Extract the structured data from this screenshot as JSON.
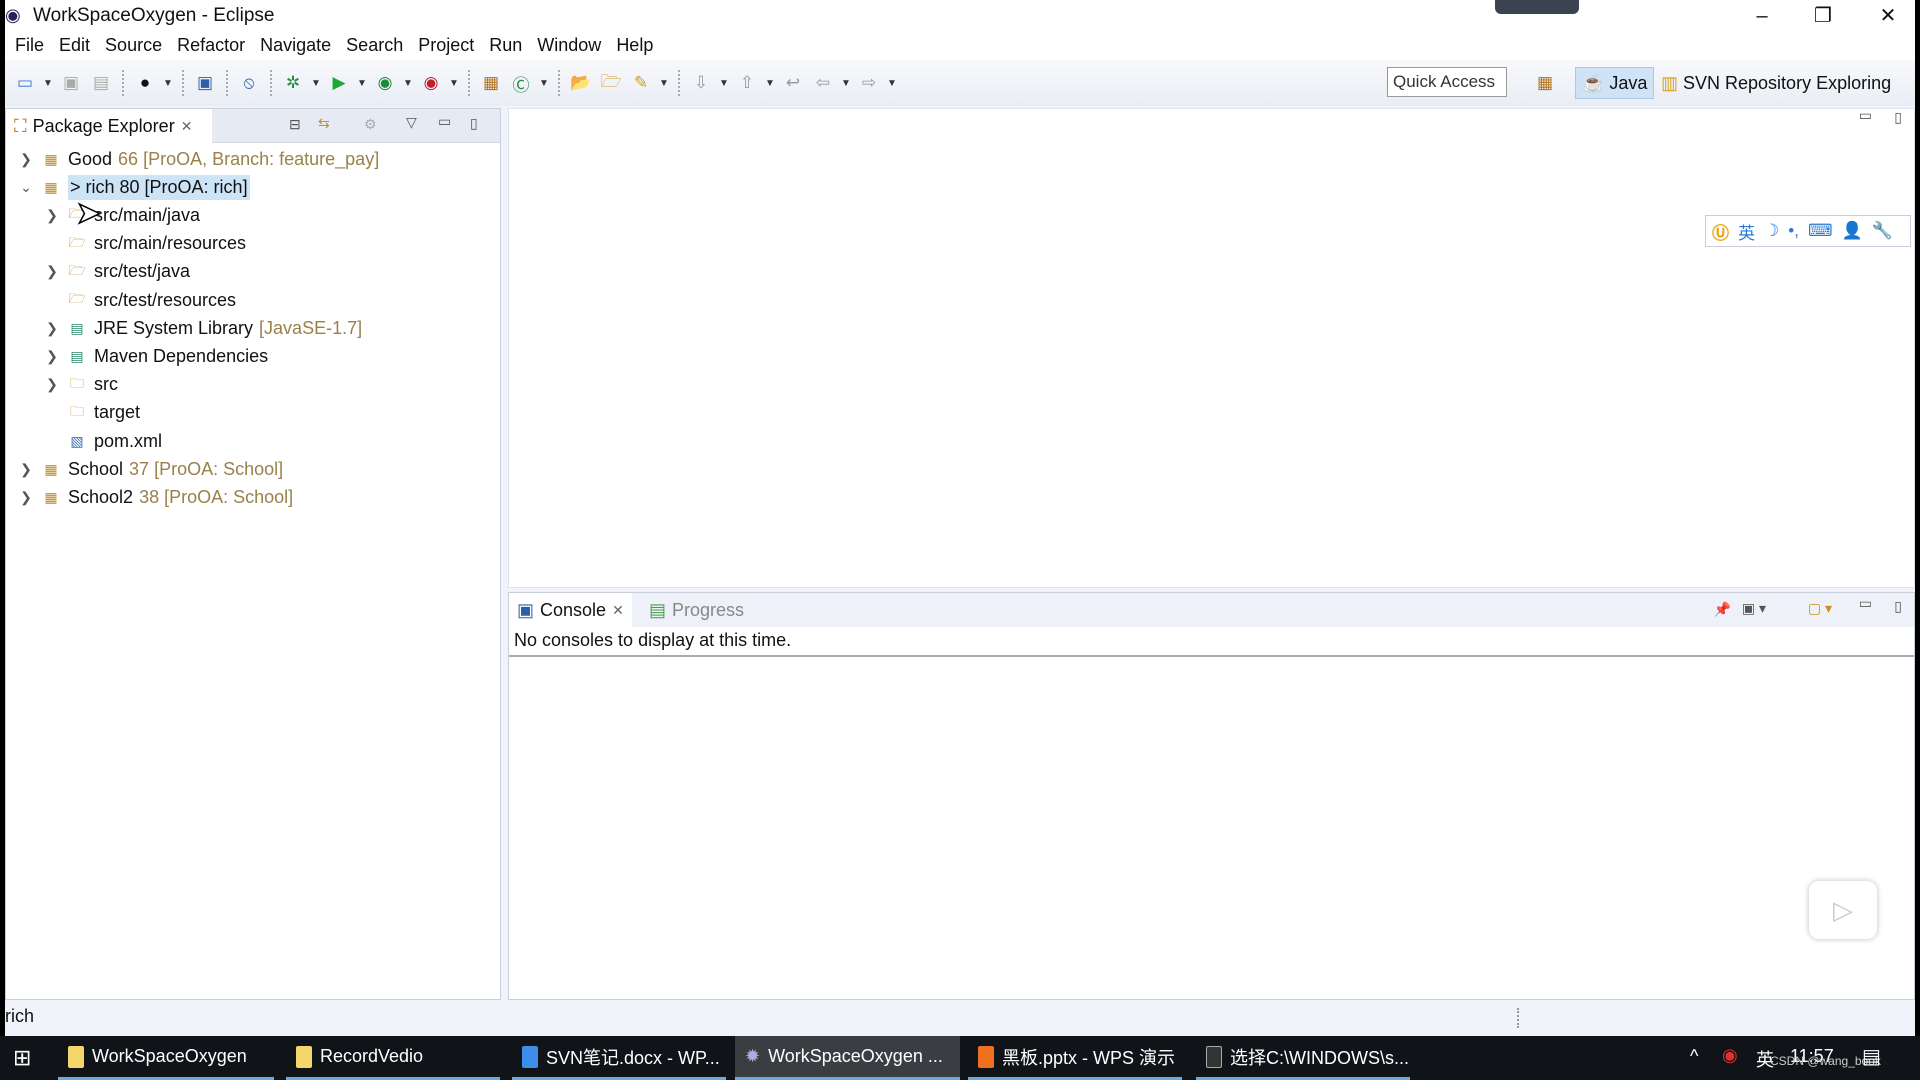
{
  "window": {
    "title": "WorkSpaceOxygen - Eclipse",
    "minimize": "–",
    "restore": "❐",
    "close": "✕"
  },
  "menu": [
    "File",
    "Edit",
    "Source",
    "Refactor",
    "Navigate",
    "Search",
    "Project",
    "Run",
    "Window",
    "Help"
  ],
  "toolbar": {
    "quick_access": "Quick Access",
    "perspectives": [
      {
        "label": "Java",
        "active": true
      },
      {
        "label": "SVN Repository Exploring",
        "active": false
      }
    ]
  },
  "package_explorer": {
    "title": "Package Explorer",
    "tree": [
      {
        "label": "Good",
        "deco": "66 [ProOA, Branch: feature_pay]",
        "level": 0,
        "expand": "collapsed",
        "icon": "maven-project-icon"
      },
      {
        "label": "> rich 80 [ProOA: rich]",
        "deco": "",
        "level": 0,
        "expand": "expanded",
        "icon": "maven-project-icon",
        "selected": true
      },
      {
        "label": "src/main/java",
        "deco": "",
        "level": 1,
        "expand": "collapsed",
        "icon": "source-folder-icon"
      },
      {
        "label": "src/main/resources",
        "deco": "",
        "level": 1,
        "expand": "none",
        "icon": "source-folder-icon"
      },
      {
        "label": "src/test/java",
        "deco": "",
        "level": 1,
        "expand": "collapsed",
        "icon": "source-folder-icon"
      },
      {
        "label": "src/test/resources",
        "deco": "",
        "level": 1,
        "expand": "none",
        "icon": "source-folder-icon"
      },
      {
        "label": "JRE System Library",
        "deco": "[JavaSE-1.7]",
        "level": 1,
        "expand": "collapsed",
        "icon": "library-icon"
      },
      {
        "label": "Maven Dependencies",
        "deco": "",
        "level": 1,
        "expand": "collapsed",
        "icon": "library-icon"
      },
      {
        "label": "src",
        "deco": "",
        "level": 1,
        "expand": "collapsed",
        "icon": "folder-icon"
      },
      {
        "label": "target",
        "deco": "",
        "level": 1,
        "expand": "none",
        "icon": "folder-icon"
      },
      {
        "label": "pom.xml",
        "deco": "",
        "level": 1,
        "expand": "none",
        "icon": "xml-file-icon"
      },
      {
        "label": "School",
        "deco": "37 [ProOA: School]",
        "level": 0,
        "expand": "collapsed",
        "icon": "maven-project-icon"
      },
      {
        "label": "School2",
        "deco": "38 [ProOA: School]",
        "level": 0,
        "expand": "collapsed",
        "icon": "maven-project-icon"
      }
    ]
  },
  "ime_bar": {
    "lang": "英"
  },
  "console": {
    "tabs": [
      "Console",
      "Progress"
    ],
    "message": "No consoles to display at this time."
  },
  "status": {
    "text": "rich"
  },
  "taskbar": {
    "items": [
      "WorkSpaceOxygen",
      "RecordVedio",
      "SVN笔记.docx - WP...",
      "WorkSpaceOxygen ...",
      "黑板.pptx - WPS 演示",
      "选择C:\\WINDOWS\\s..."
    ],
    "tray_lang": "英",
    "clock": "11:57",
    "watermark": "CSDN @wang_book"
  }
}
